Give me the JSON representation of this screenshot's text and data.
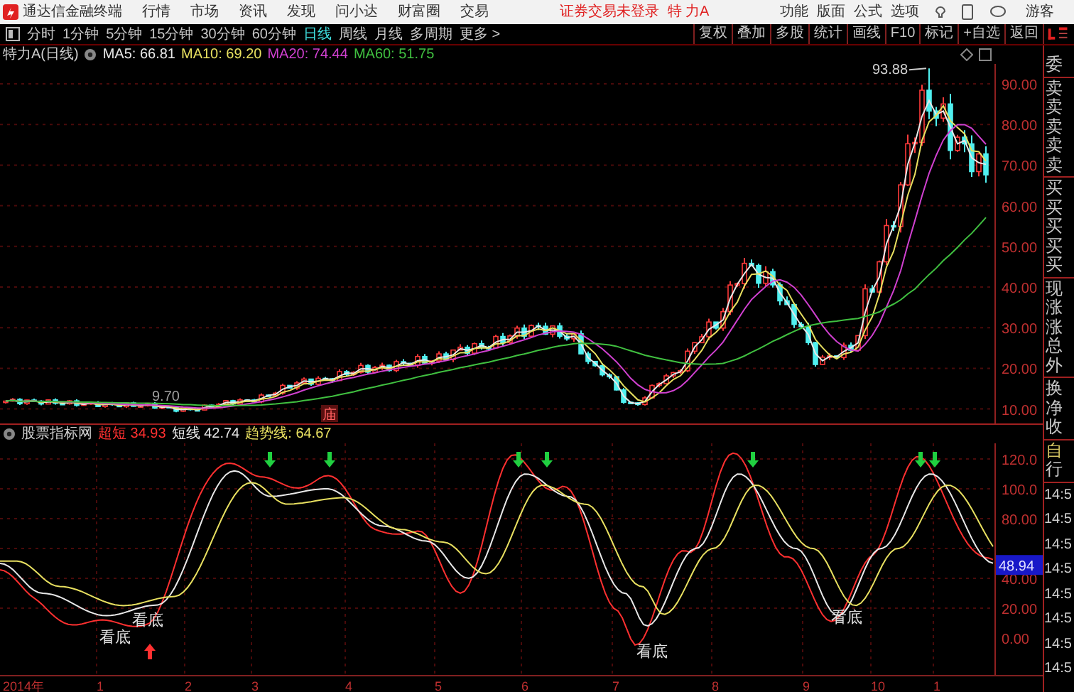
{
  "app": {
    "title": "通达信金融终端",
    "menus": [
      "行情",
      "市场",
      "资讯",
      "发现",
      "问小达",
      "财富圈",
      "交易"
    ],
    "notice": "证券交易未登录",
    "stock": "特 力A",
    "tools": [
      "功能",
      "版面",
      "公式",
      "选项"
    ],
    "user": "游客"
  },
  "periods": [
    {
      "label": "分时",
      "selected": false
    },
    {
      "label": "1分钟",
      "selected": false
    },
    {
      "label": "5分钟",
      "selected": false
    },
    {
      "label": "15分钟",
      "selected": false
    },
    {
      "label": "30分钟",
      "selected": false
    },
    {
      "label": "60分钟",
      "selected": false
    },
    {
      "label": "日线",
      "selected": true
    },
    {
      "label": "周线",
      "selected": false
    },
    {
      "label": "月线",
      "selected": false
    },
    {
      "label": "多周期",
      "selected": false
    }
  ],
  "more_menu": "更多 >",
  "toolbar_buttons": [
    "复权",
    "叠加",
    "多股",
    "统计",
    "画线",
    "F10",
    "标记",
    "+自选",
    "返回"
  ],
  "price_chart": {
    "title": "特力A(日线)",
    "indicators": [
      {
        "label": "MA5: 66.81",
        "color": "#e8e8e8"
      },
      {
        "label": "MA10: 69.20",
        "color": "#e8e060"
      },
      {
        "label": "MA20: 74.44",
        "color": "#d040d0"
      },
      {
        "label": "MA60: 51.75",
        "color": "#40c040"
      }
    ],
    "axis": [
      "90.00",
      "80.00",
      "70.00",
      "60.00",
      "50.00",
      "40.00",
      "30.00",
      "20.00",
      "10.00"
    ],
    "high_label": "93.88",
    "low_label": "9.70",
    "marker": "庙"
  },
  "indicator_chart": {
    "title": "股票指标网",
    "values": [
      {
        "label": "超短",
        "value": "34.93",
        "color": "#ff3030"
      },
      {
        "label": "短线",
        "value": "42.74",
        "color": "#e8e8e8"
      },
      {
        "label": "趋势线:",
        "value": "64.67",
        "color": "#e8e060"
      }
    ],
    "axis": [
      "120.0",
      "100.0",
      "80.00",
      "40.00",
      "20.00",
      "0.00"
    ],
    "current_value": "48.94",
    "signals": [
      "看底",
      "看底",
      "看底",
      "看底"
    ]
  },
  "x_axis": [
    "2014年",
    "1",
    "2",
    "3",
    "4",
    "5",
    "6",
    "7",
    "8",
    "9",
    "10",
    "1"
  ],
  "quote_panel": {
    "groups": [
      [
        "委"
      ],
      [
        "卖",
        "卖",
        "卖",
        "卖",
        "卖"
      ],
      [
        "买",
        "买",
        "买",
        "买",
        "买"
      ],
      [
        "现",
        "涨",
        "涨",
        "总",
        "外"
      ],
      [
        "换",
        "净",
        "收"
      ]
    ],
    "modes": [
      "自",
      "行"
    ],
    "times": [
      "14:5",
      "14:5",
      "14:5",
      "14:5",
      "14:5",
      "14:5",
      "14:5",
      "14:5"
    ]
  }
}
